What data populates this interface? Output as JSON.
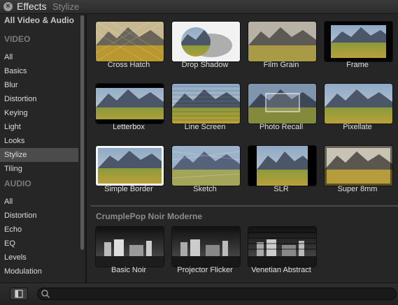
{
  "window": {
    "title": "Effects",
    "subtitle": "Stylize"
  },
  "sidebar": {
    "top_item": "All Video & Audio",
    "video_header": "VIDEO",
    "video_items": [
      "All",
      "Basics",
      "Blur",
      "Distortion",
      "Keying",
      "Light",
      "Looks",
      "Stylize",
      "Tiling"
    ],
    "selected": "Stylize",
    "audio_header": "AUDIO",
    "audio_items": [
      "All",
      "Distortion",
      "Echo",
      "EQ",
      "Levels",
      "Modulation"
    ]
  },
  "effects": {
    "row1": [
      "Cross Hatch",
      "Drop Shadow",
      "Film Grain",
      "Frame"
    ],
    "row2": [
      "Letterbox",
      "Line Screen",
      "Photo Recall",
      "Pixellate"
    ],
    "row3": [
      "Simple Border",
      "Sketch",
      "SLR",
      "Super 8mm"
    ]
  },
  "noir": {
    "section_title": "CrumplePop Noir Moderne",
    "items": [
      "Basic Noir",
      "Projector Flicker",
      "Venetian Abstract"
    ]
  },
  "search": {
    "placeholder": "",
    "value": ""
  },
  "colors": {
    "sky": "#6f8fb0",
    "mountain": "#465265",
    "field": "#9a9a3a",
    "selection": "#4b4b4b"
  }
}
